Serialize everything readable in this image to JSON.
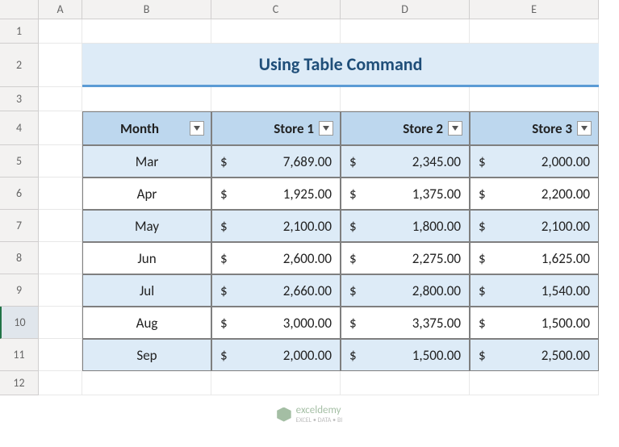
{
  "columns": [
    "A",
    "B",
    "C",
    "D",
    "E"
  ],
  "rows": [
    "1",
    "2",
    "3",
    "4",
    "5",
    "6",
    "7",
    "8",
    "9",
    "10",
    "11",
    "12"
  ],
  "selected_row": "10",
  "title": "Using Table Command",
  "headers": [
    "Month",
    "Store 1",
    "Store 2",
    "Store 3"
  ],
  "currency_symbol": "$",
  "data": [
    {
      "month": "Mar",
      "s1": "7,689.00",
      "s2": "2,345.00",
      "s3": "2,000.00"
    },
    {
      "month": "Apr",
      "s1": "1,925.00",
      "s2": "1,375.00",
      "s3": "2,200.00"
    },
    {
      "month": "May",
      "s1": "2,100.00",
      "s2": "1,800.00",
      "s3": "2,100.00"
    },
    {
      "month": "Jun",
      "s1": "2,600.00",
      "s2": "2,275.00",
      "s3": "1,625.00"
    },
    {
      "month": "Jul",
      "s1": "2,660.00",
      "s2": "2,800.00",
      "s3": "1,540.00"
    },
    {
      "month": "Aug",
      "s1": "3,000.00",
      "s2": "3,375.00",
      "s3": "1,500.00"
    },
    {
      "month": "Sep",
      "s1": "2,000.00",
      "s2": "1,500.00",
      "s3": "2,500.00"
    }
  ],
  "watermark": {
    "brand": "exceldemy",
    "tagline": "EXCEL • DATA • BI"
  },
  "chart_data": {
    "type": "table",
    "title": "Using Table Command",
    "columns": [
      "Month",
      "Store 1",
      "Store 2",
      "Store 3"
    ],
    "rows": [
      [
        "Mar",
        7689.0,
        2345.0,
        2000.0
      ],
      [
        "Apr",
        1925.0,
        1375.0,
        2200.0
      ],
      [
        "May",
        2100.0,
        1800.0,
        2100.0
      ],
      [
        "Jun",
        2600.0,
        2275.0,
        1625.0
      ],
      [
        "Jul",
        2660.0,
        2800.0,
        1540.0
      ],
      [
        "Aug",
        3000.0,
        3375.0,
        1500.0
      ],
      [
        "Sep",
        2000.0,
        1500.0,
        2500.0
      ]
    ]
  }
}
